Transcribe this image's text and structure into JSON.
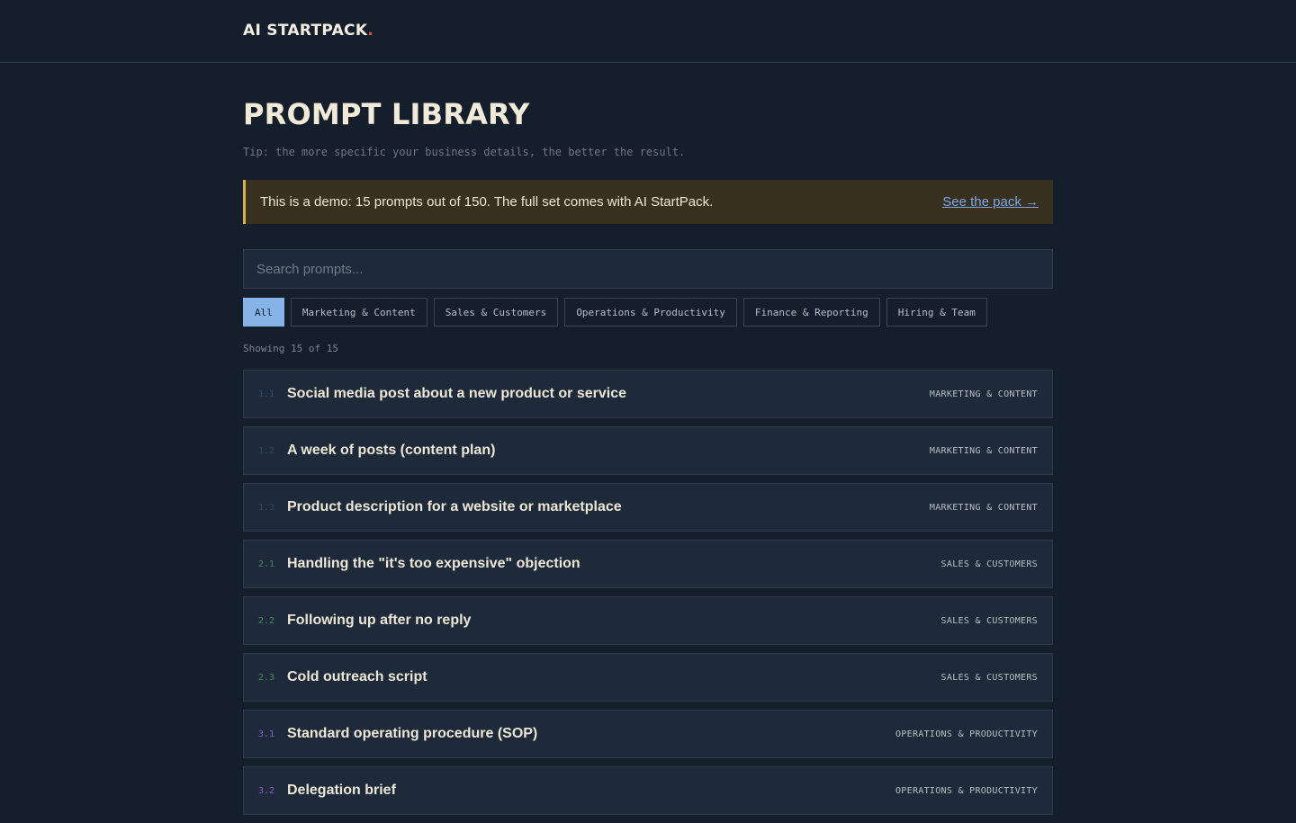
{
  "brand": {
    "name": "AI STARTPACK",
    "dot": "."
  },
  "page": {
    "title": "PROMPT LIBRARY",
    "tip": "Tip: the more specific your business details, the better the result."
  },
  "banner": {
    "text": "This is a demo: 15 prompts out of 150. The full set comes with AI StartPack.",
    "link": "See the pack →",
    "accent": "#d9b04e"
  },
  "search": {
    "placeholder": "Search prompts..."
  },
  "filters": [
    {
      "label": "All",
      "active": true
    },
    {
      "label": "Marketing & Content",
      "active": false
    },
    {
      "label": "Sales & Customers",
      "active": false
    },
    {
      "label": "Operations & Productivity",
      "active": false
    },
    {
      "label": "Finance & Reporting",
      "active": false
    },
    {
      "label": "Hiring & Team",
      "active": false
    }
  ],
  "count": "Showing 15 of 15",
  "prompts": [
    {
      "num": "1.1",
      "title": "Social media post about a new product or service",
      "category": "MARKETING & CONTENT",
      "group": "c1"
    },
    {
      "num": "1.2",
      "title": "A week of posts (content plan)",
      "category": "MARKETING & CONTENT",
      "group": "c1"
    },
    {
      "num": "1.3",
      "title": "Product description for a website or marketplace",
      "category": "MARKETING & CONTENT",
      "group": "c1"
    },
    {
      "num": "2.1",
      "title": "Handling the \"it's too expensive\" objection",
      "category": "SALES & CUSTOMERS",
      "group": "c2"
    },
    {
      "num": "2.2",
      "title": "Following up after no reply",
      "category": "SALES & CUSTOMERS",
      "group": "c2"
    },
    {
      "num": "2.3",
      "title": "Cold outreach script",
      "category": "SALES & CUSTOMERS",
      "group": "c2"
    },
    {
      "num": "3.1",
      "title": "Standard operating procedure (SOP)",
      "category": "OPERATIONS & PRODUCTIVITY",
      "group": "c3"
    },
    {
      "num": "3.2",
      "title": "Delegation brief",
      "category": "OPERATIONS & PRODUCTIVITY",
      "group": "c3"
    }
  ]
}
